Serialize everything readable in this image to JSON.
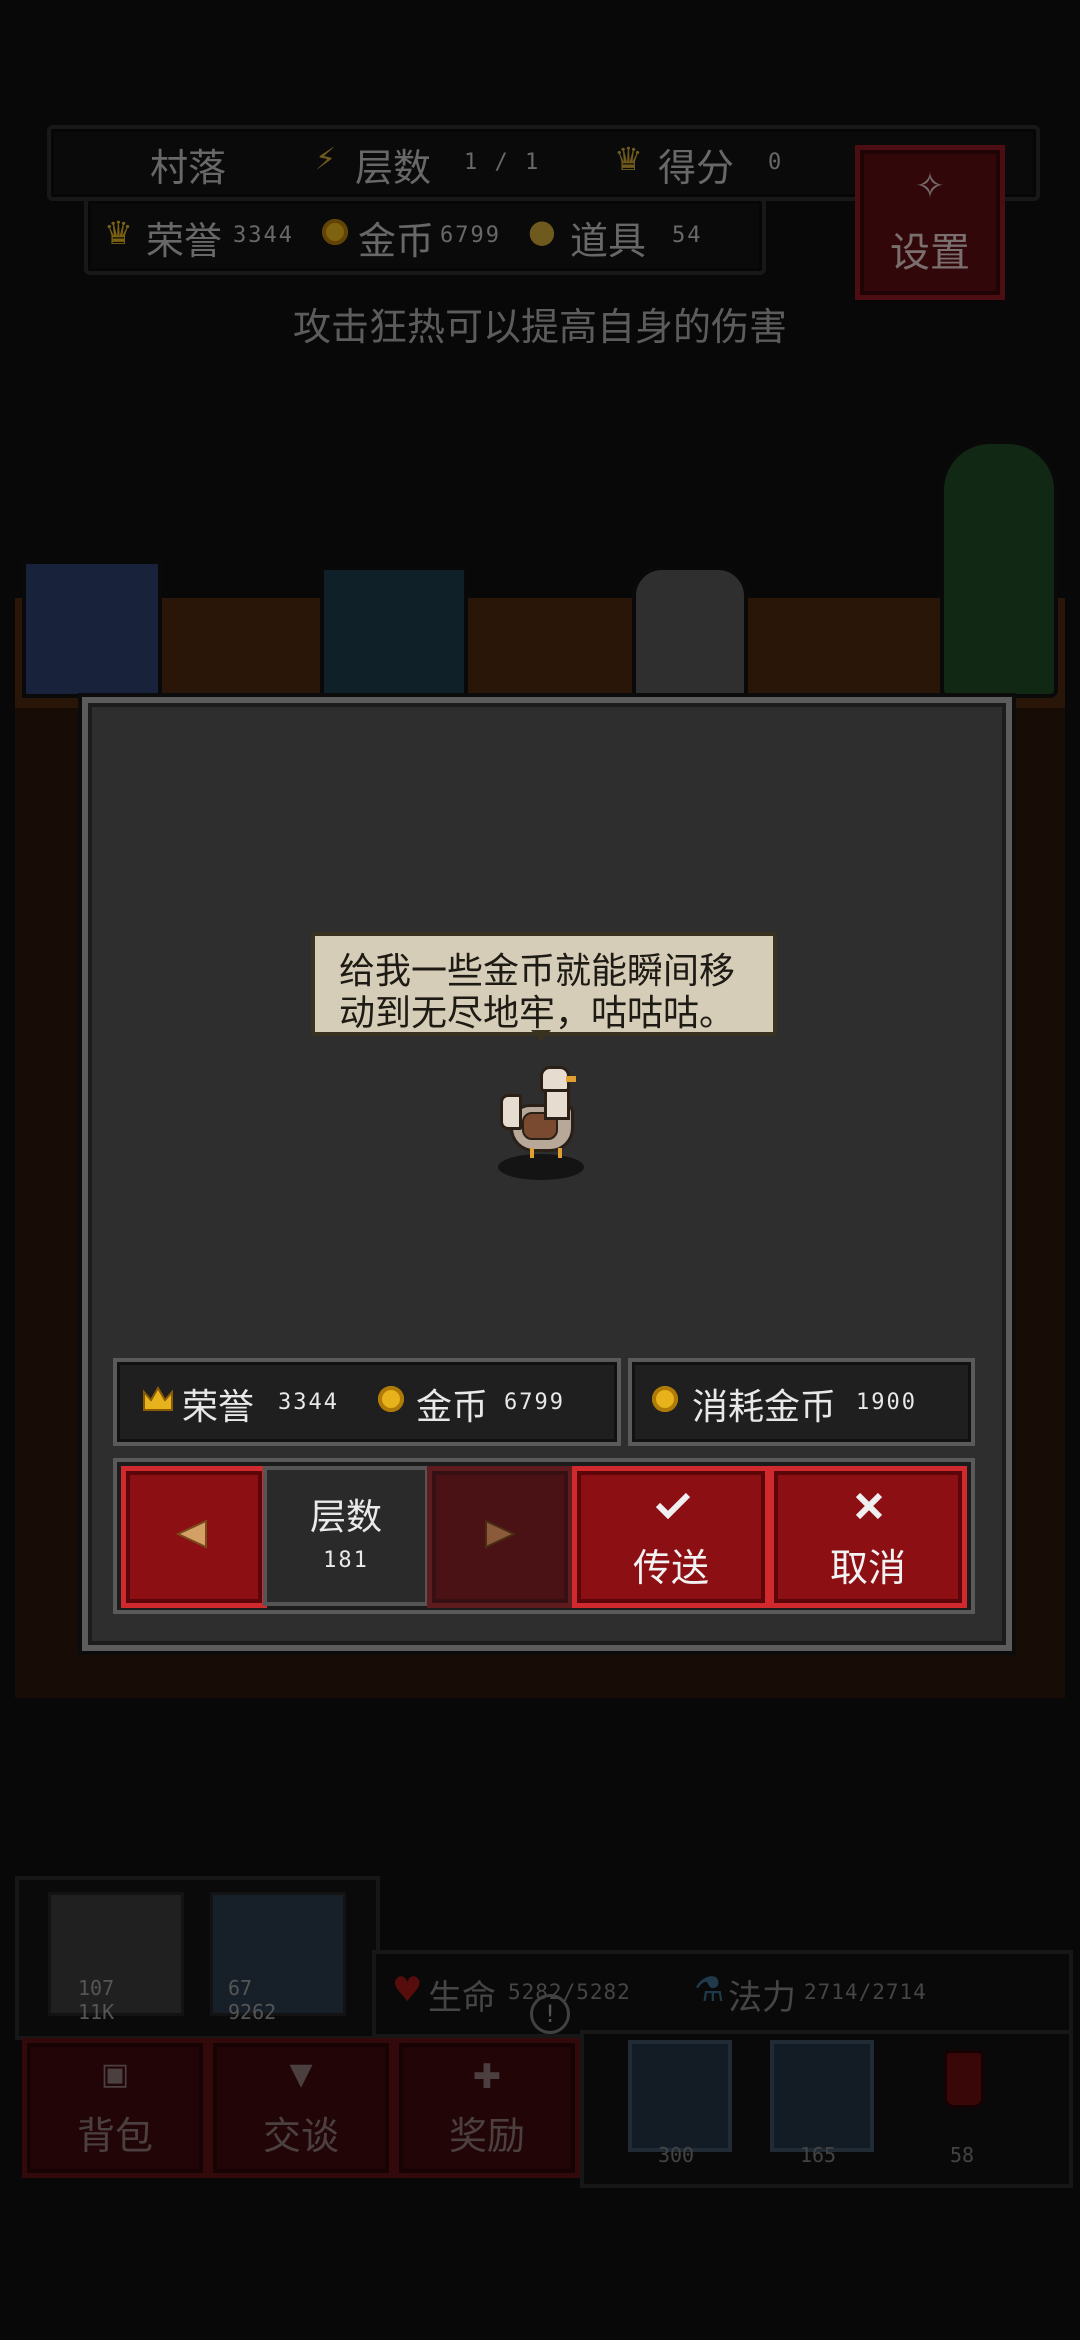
{
  "hud": {
    "location": "村落",
    "floor_label": "层数",
    "floor_value": "1 / 1",
    "score_label": "得分",
    "score_value": "0",
    "honor_label": "荣誉",
    "honor_value": "3344",
    "gold_label": "金币",
    "gold_value": "6799",
    "items_label": "道具",
    "items_value": "54",
    "settings_label": "设置"
  },
  "hint": "攻击狂热可以提高自身的伤害",
  "dialog": {
    "speech_line1": "给我一些金币就能瞬间移",
    "speech_line2": "动到无尽地牢，咕咕咕。",
    "honor_label": "荣誉",
    "honor_value": "3344",
    "gold_label": "金币",
    "gold_value": "6799",
    "cost_label": "消耗金币",
    "cost_value": "1900",
    "floor_label": "层数",
    "floor_value": "181",
    "teleport_label": "传送",
    "cancel_label": "取消"
  },
  "party": {
    "hero1_atk": "107",
    "hero1_hp": "11K",
    "hero2_atk": "67",
    "hero2_hp": "9262"
  },
  "stats": {
    "hp_label": "生命",
    "hp_value": "5282/5282",
    "mp_label": "法力",
    "mp_value": "2714/2714"
  },
  "menu": {
    "bag_label": "背包",
    "talk_label": "交谈",
    "reward_label": "奖励"
  },
  "skills": {
    "skill1_cost": "300",
    "skill2_cost": "165",
    "potion_count": "58"
  },
  "colors": {
    "button_red": "#8c0f14",
    "button_border": "#d02a2f",
    "dialog_bg": "#2e2e2e",
    "coin": "#e7b21c",
    "speech_bg": "#d6cdb8"
  }
}
